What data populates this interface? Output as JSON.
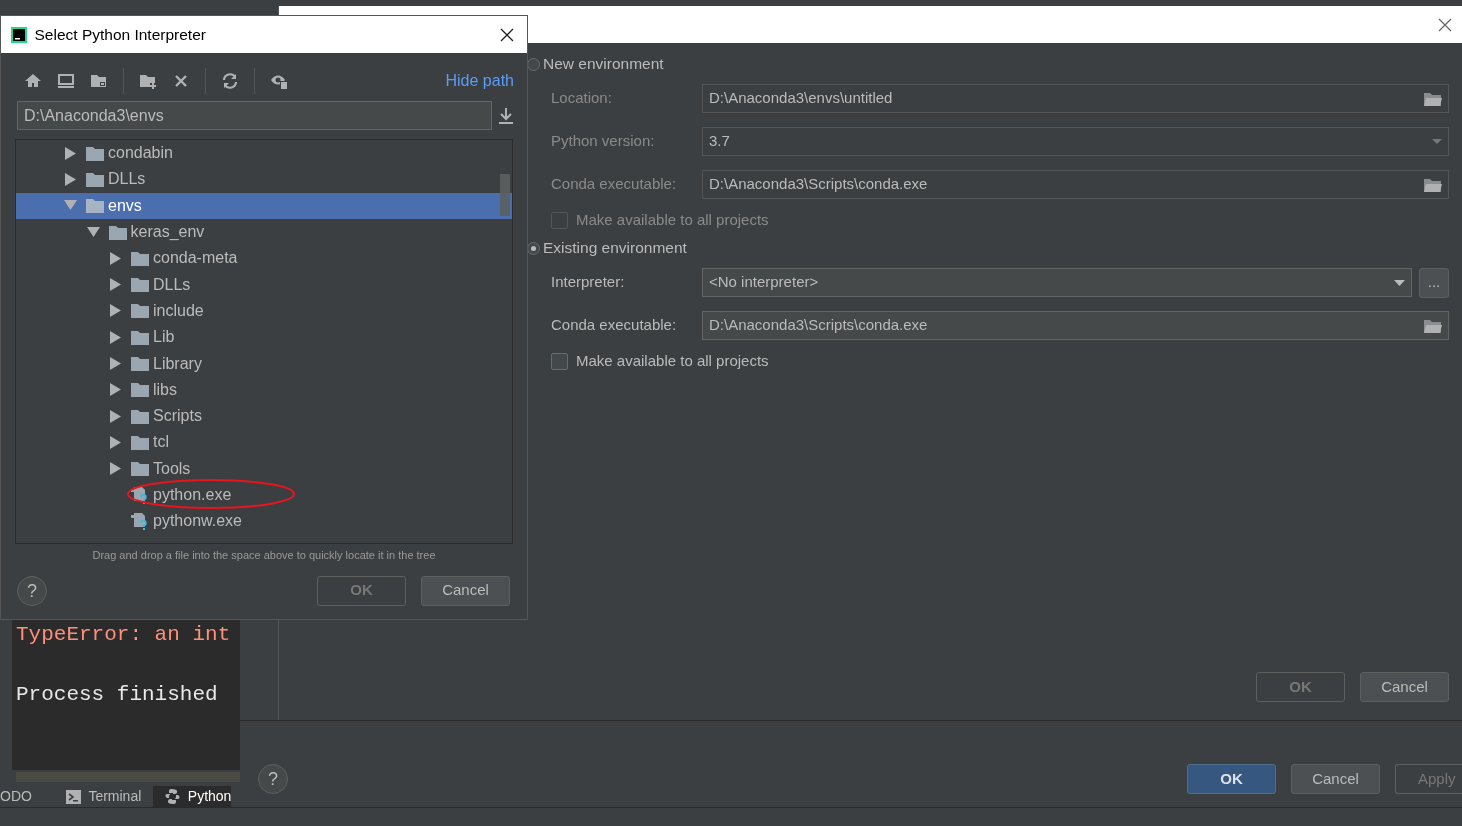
{
  "console": {
    "lines": [
      {
        "text": "TypeError: an int",
        "kind": "error"
      },
      {
        "text": "Process finished",
        "kind": "normal"
      }
    ]
  },
  "tool_tabs": [
    {
      "label": "ODO",
      "kind": "plain",
      "selected": false
    },
    {
      "label": "Terminal",
      "kind": "terminal",
      "selected": false
    },
    {
      "label": "Python",
      "kind": "python",
      "selected": true
    }
  ],
  "settings_dialog": {
    "help_button": "?",
    "buttons": [
      {
        "label": "OK",
        "kind": "primary"
      },
      {
        "label": "Cancel",
        "kind": "normal"
      },
      {
        "label": "Apply",
        "kind": "disabled"
      }
    ]
  },
  "add_interpreter_dialog": {
    "sections": [
      {
        "label": "New environment",
        "selected": false,
        "fields": [
          {
            "label": "Location:",
            "kind": "path",
            "value": "D:\\Anaconda3\\envs\\untitled"
          },
          {
            "label": "Python version:",
            "kind": "select",
            "value": "3.7"
          },
          {
            "label": "Conda executable:",
            "kind": "path",
            "value": "D:\\Anaconda3\\Scripts\\conda.exe"
          },
          {
            "label": "Make available to all projects",
            "kind": "checkbox",
            "checked": false
          }
        ]
      },
      {
        "label": "Existing environment",
        "selected": true,
        "fields": [
          {
            "label": "Interpreter:",
            "kind": "combo",
            "value": "<No interpreter>",
            "browse_button": "..."
          },
          {
            "label": "Conda executable:",
            "kind": "path",
            "value": "D:\\Anaconda3\\Scripts\\conda.exe"
          },
          {
            "label": "Make available to all projects",
            "kind": "checkbox",
            "checked": false
          }
        ]
      }
    ],
    "buttons": [
      {
        "label": "OK",
        "disabled": true
      },
      {
        "label": "Cancel",
        "disabled": false
      }
    ]
  },
  "select_dialog": {
    "title": "Select Python Interpreter",
    "help_button": "?",
    "hide_path_link": "Hide path",
    "path": "D:\\Anaconda3\\envs",
    "tree": [
      {
        "label": "condabin",
        "kind": "folder",
        "expanded": false,
        "selected": false
      },
      {
        "label": "DLLs",
        "kind": "folder",
        "expanded": false,
        "selected": false
      },
      {
        "label": "envs",
        "kind": "folder",
        "expanded": true,
        "selected": true,
        "children": [
          {
            "label": "keras_env",
            "kind": "folder",
            "expanded": true,
            "selected": false,
            "children": [
              {
                "label": "conda-meta",
                "kind": "folder",
                "expanded": false,
                "selected": false
              },
              {
                "label": "DLLs",
                "kind": "folder",
                "expanded": false,
                "selected": false
              },
              {
                "label": "include",
                "kind": "folder",
                "expanded": false,
                "selected": false
              },
              {
                "label": "Lib",
                "kind": "folder",
                "expanded": false,
                "selected": false
              },
              {
                "label": "Library",
                "kind": "folder",
                "expanded": false,
                "selected": false
              },
              {
                "label": "libs",
                "kind": "folder",
                "expanded": false,
                "selected": false
              },
              {
                "label": "Scripts",
                "kind": "folder",
                "expanded": false,
                "selected": false
              },
              {
                "label": "tcl",
                "kind": "folder",
                "expanded": false,
                "selected": false
              },
              {
                "label": "Tools",
                "kind": "folder",
                "expanded": false,
                "selected": false
              },
              {
                "label": "python.exe",
                "kind": "file",
                "selected": false,
                "circled": true
              },
              {
                "label": "pythonw.exe",
                "kind": "file",
                "selected": false,
                "circled": false
              }
            ]
          }
        ]
      }
    ],
    "hint": "Drag and drop a file into the space above to quickly locate it in the tree",
    "buttons": [
      {
        "label": "OK",
        "disabled": true
      },
      {
        "label": "Cancel",
        "disabled": false
      }
    ]
  }
}
